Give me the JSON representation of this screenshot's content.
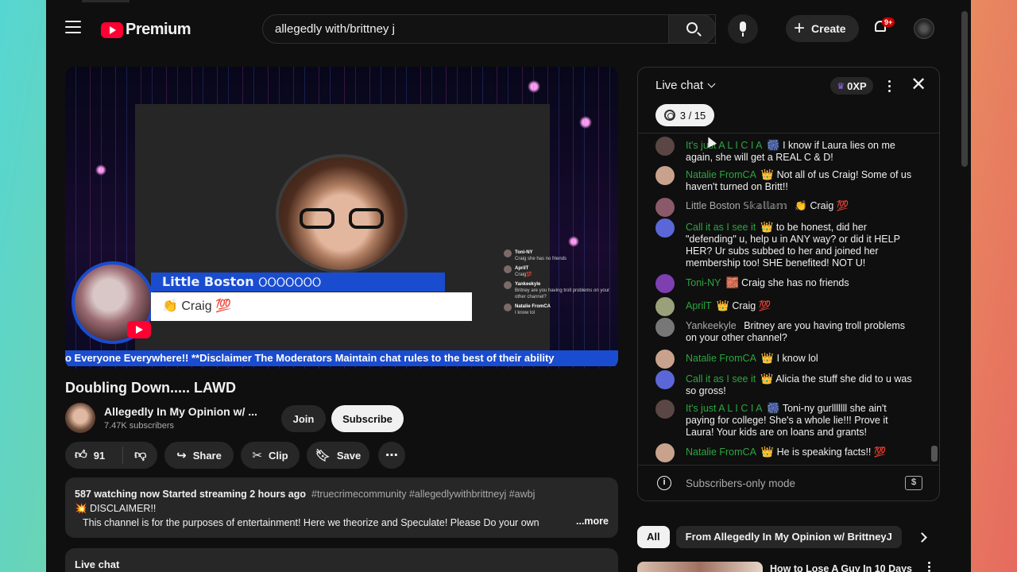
{
  "header": {
    "logo_text": "Premium",
    "search_value": "allegedly with/brittney j",
    "create_label": "Create",
    "notif_badge": "9+"
  },
  "video": {
    "overlay_name": "Little Boston 𝙾𝙾𝙾𝙾𝙾𝙾𝙾",
    "overlay_name_short": "Little Boston",
    "overlay_message": "👏 Craig 💯",
    "ticker": "o Everyone Everywhere!! **Disclaimer The Moderators Maintain chat rules to the best of their ability",
    "mini_chat": [
      {
        "author": "Toni-NY",
        "text": "Craig she has no friends"
      },
      {
        "author": "AprilT",
        "text": "Craig💯"
      },
      {
        "author": "Yankeekyle",
        "text": "Britney are you having troll problems on your other channel?"
      },
      {
        "author": "Natalie FromCA",
        "text": "I know lol"
      }
    ]
  },
  "title": "Doubling Down..... LAWD",
  "channel": {
    "name": "Allegedly In My Opinion w/ ...",
    "subscribers": "7.47K subscribers",
    "join_label": "Join",
    "subscribe_label": "Subscribe"
  },
  "actions": {
    "likes": "91",
    "share": "Share",
    "clip": "Clip",
    "save": "Save"
  },
  "description": {
    "stats": "587 watching now  Started streaming 2 hours ago",
    "tags": "#truecrimecommunity #allegedlywithbrittneyj #awbj",
    "line2": "💥 DISCLAIMER!!",
    "line3": "This channel is for the purposes of entertainment!  Here we theorize and Speculate!  Please Do your own",
    "more": "...more"
  },
  "live_chat_bar": "Live chat",
  "chat": {
    "title": "Live chat",
    "xp": "0XP",
    "goal": "3 / 15",
    "messages": [
      {
        "author": "It's just A L I C I A",
        "badge": "🎆",
        "text": "I know if Laura lies on me again, she will get a REAL C & D!",
        "av": "#5a4644"
      },
      {
        "author": "Natalie FromCA",
        "badge": "👑",
        "text": "Not all of us Craig! Some of us haven't turned on Britt!!",
        "av": "#c9a28e"
      },
      {
        "author": "Little Boston 𝕊𝕜𝕒𝕝𝕝𝕒𝕞",
        "badge": "",
        "text": "👏 Craig 💯",
        "av": "#8a5a6a"
      },
      {
        "author": "Call it as I see it",
        "badge": "👑",
        "text": "to be honest, did her \"defending\" u, help u in ANY way? or did it HELP HER? Ur subs subbed to her and joined her membership too! SHE benefited! NOT U!",
        "av": "#5b67d8"
      },
      {
        "author": "Toni-NY",
        "badge": "🧱",
        "text": "Craig she has no friends",
        "av": "#7e3fb0"
      },
      {
        "author": "AprilT",
        "badge": "👑",
        "text": "Craig 💯",
        "av": "#9aa07a"
      },
      {
        "author": "Yankeekyle",
        "badge": "",
        "text": "Britney are you having troll problems on your other channel?",
        "av": "#777777"
      },
      {
        "author": "Natalie FromCA",
        "badge": "👑",
        "text": "I know lol",
        "av": "#c9a28e"
      },
      {
        "author": "Call it as I see it",
        "badge": "👑",
        "text": "Alicia the stuff she did to u was so gross!",
        "av": "#5b67d8"
      },
      {
        "author": "It's just A L I C I A",
        "badge": "🎆",
        "text": "Toni-ny gurlllllll she ain't paying for college! She's a whole lie!!! Prove it Laura! Your kids are on loans and grants!",
        "av": "#5a4644"
      },
      {
        "author": "Natalie FromCA",
        "badge": "👑",
        "text": "He is speaking facts!! 💯",
        "av": "#c9a28e"
      }
    ],
    "subscribers_only": "Subscribers-only mode",
    "dollar": "$"
  },
  "chips": [
    "All",
    "From Allegedly In My Opinion w/ BrittneyJ"
  ],
  "recommendation": {
    "title": "How to Lose A Guy In 10 Days"
  },
  "colors": {
    "accent_red": "#ff0033",
    "author_green": "#2ba640",
    "overlay_blue": "#1a4cd0"
  }
}
